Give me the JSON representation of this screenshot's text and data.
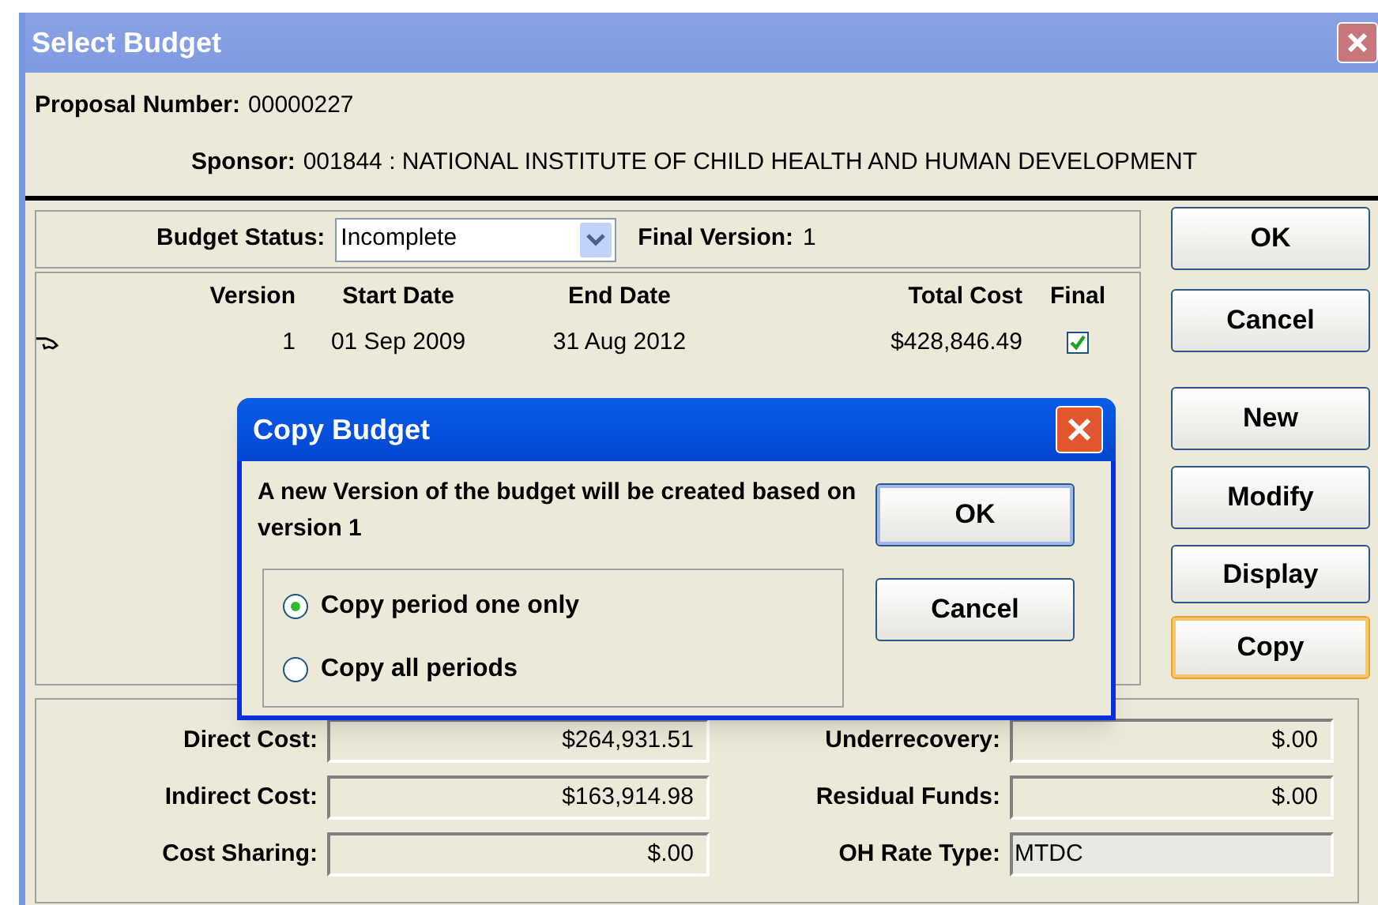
{
  "window": {
    "title": "Select Budget"
  },
  "proposal": {
    "label": "Proposal Number:",
    "value": "00000227"
  },
  "sponsor": {
    "label": "Sponsor:",
    "value": "001844 : NATIONAL INSTITUTE OF CHILD HEALTH AND HUMAN DEVELOPMENT"
  },
  "budget_status": {
    "label": "Budget Status:",
    "value": "Incomplete"
  },
  "final_version": {
    "label": "Final Version:",
    "value": "1"
  },
  "table": {
    "columns": [
      "Version",
      "Start Date",
      "End Date",
      "Total Cost",
      "Final"
    ],
    "rows": [
      {
        "current": true,
        "version": "1",
        "start_date": "01 Sep 2009",
        "end_date": "31 Aug 2012",
        "total_cost": "$428,846.49",
        "final": true
      }
    ]
  },
  "buttons": [
    {
      "label": "OK",
      "focused": false
    },
    {
      "label": "Cancel",
      "focused": false
    },
    {
      "label": "New",
      "focused": false
    },
    {
      "label": "Modify",
      "focused": false
    },
    {
      "label": "Display",
      "focused": false
    },
    {
      "label": "Copy",
      "focused": true
    }
  ],
  "summary": [
    {
      "label": "Direct Cost:",
      "value": "$264,931.51",
      "kind": "amount"
    },
    {
      "label": "Underrecovery:",
      "value": "$.00",
      "kind": "amount"
    },
    {
      "label": "Indirect Cost:",
      "value": "$163,914.98",
      "kind": "amount"
    },
    {
      "label": "Residual Funds:",
      "value": "$.00",
      "kind": "amount"
    },
    {
      "label": "Cost Sharing:",
      "value": "$.00",
      "kind": "amount"
    },
    {
      "label": "OH Rate Type:",
      "value": "MTDC",
      "kind": "text"
    }
  ],
  "dialog": {
    "title": "Copy Budget",
    "message": "A new Version of the budget will be created based on version 1",
    "options": [
      {
        "label": "Copy period one only",
        "selected": true
      },
      {
        "label": "Copy all periods",
        "selected": false
      }
    ],
    "buttons": [
      {
        "label": "OK",
        "default": true
      },
      {
        "label": "Cancel",
        "default": false
      }
    ]
  }
}
